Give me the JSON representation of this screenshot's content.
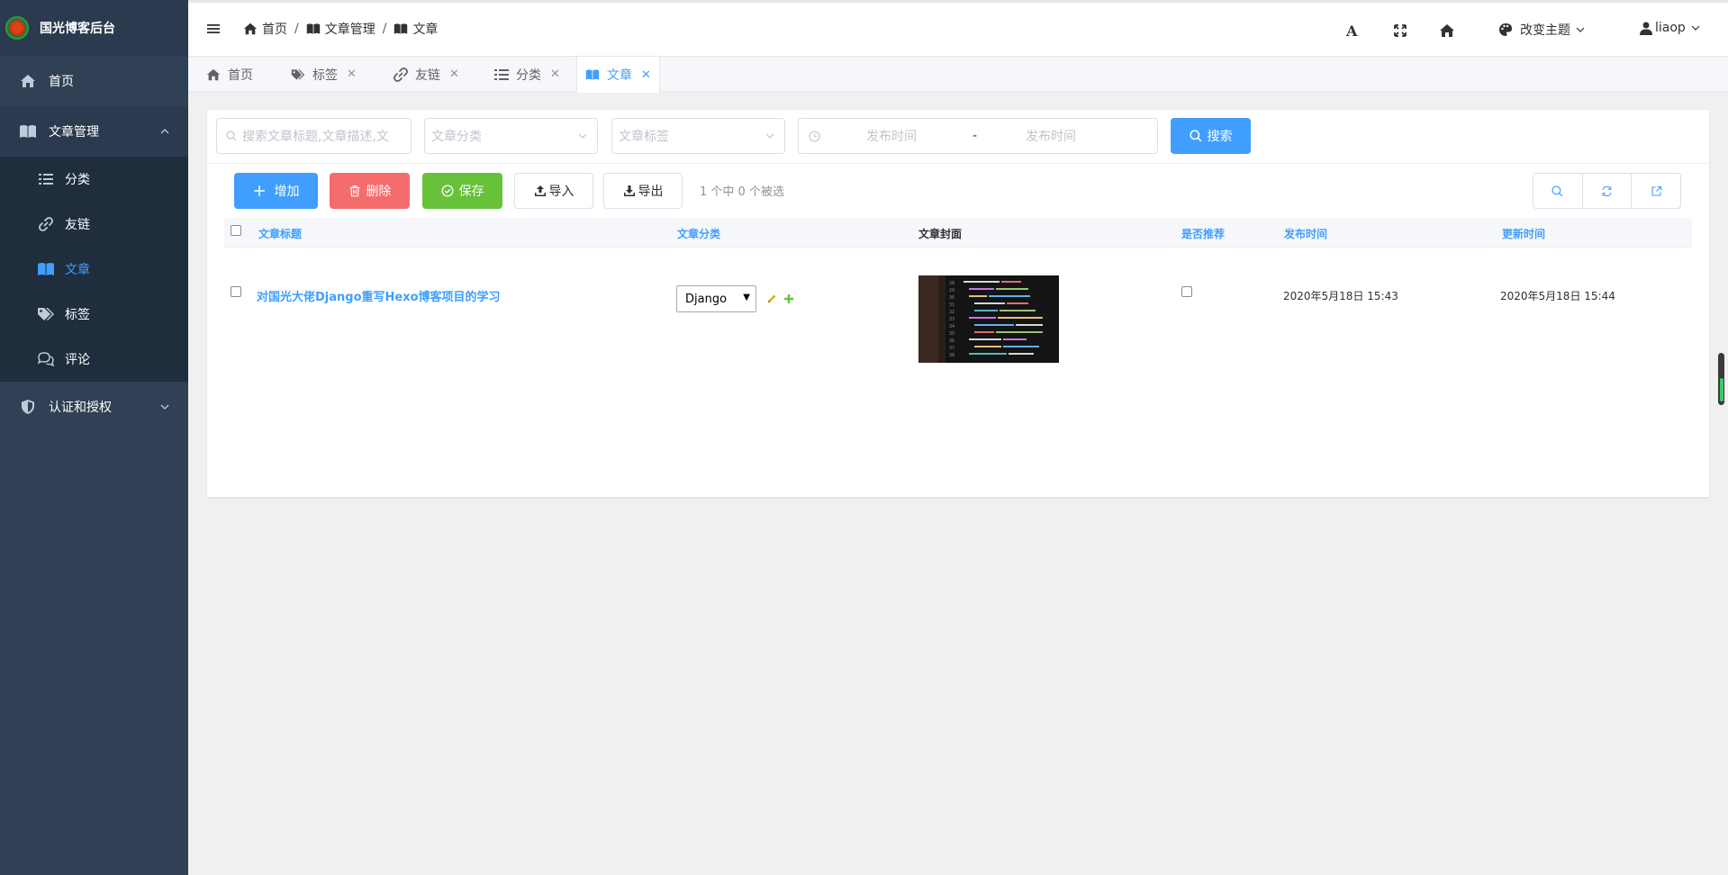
{
  "brand": {
    "title": "国光博客后台"
  },
  "sidebar": {
    "items": [
      {
        "label": "首页",
        "icon": "home-icon"
      },
      {
        "label": "文章管理",
        "icon": "book-icon"
      },
      {
        "label": "认证和授权",
        "icon": "shield-icon"
      }
    ],
    "sub_items": [
      {
        "label": "分类",
        "icon": "list-icon"
      },
      {
        "label": "友链",
        "icon": "link-icon"
      },
      {
        "label": "文章",
        "icon": "book-icon"
      },
      {
        "label": "标签",
        "icon": "tags-icon"
      },
      {
        "label": "评论",
        "icon": "comments-icon"
      }
    ]
  },
  "breadcrumb": [
    {
      "label": "首页"
    },
    {
      "label": "文章管理"
    },
    {
      "label": "文章"
    }
  ],
  "topbar": {
    "theme_label": "改变主题",
    "user_label": "liaop"
  },
  "tabs": [
    {
      "label": "首页",
      "closable": false
    },
    {
      "label": "标签",
      "closable": true
    },
    {
      "label": "友链",
      "closable": true
    },
    {
      "label": "分类",
      "closable": true
    },
    {
      "label": "文章",
      "closable": true,
      "active": true
    }
  ],
  "filters": {
    "search_placeholder": "搜索文章标题,文章描述,文",
    "category_placeholder": "文章分类",
    "tag_placeholder": "文章标签",
    "date_start_placeholder": "发布时间",
    "date_sep": "-",
    "date_end_placeholder": "发布时间",
    "search_button": "搜索"
  },
  "actions": {
    "add": "增加",
    "delete": "删除",
    "save": "保存",
    "import": "导入",
    "export": "导出",
    "selection_text": "1 个中 0 个被选"
  },
  "table": {
    "headers": {
      "title": "文章标题",
      "category": "文章分类",
      "cover": "文章封面",
      "recommended": "是否推荐",
      "published": "发布时间",
      "updated": "更新时间"
    },
    "rows": [
      {
        "title": "对国光大佬Django重写Hexo博客项目的学习",
        "category": "Django",
        "recommended": false,
        "published": "2020年5月18日 15:43",
        "updated": "2020年5月18日 15:44"
      }
    ]
  },
  "colors": {
    "sidebar_bg": "#304156",
    "primary": "#409eff",
    "danger": "#f56c6c",
    "success": "#67c23a"
  }
}
